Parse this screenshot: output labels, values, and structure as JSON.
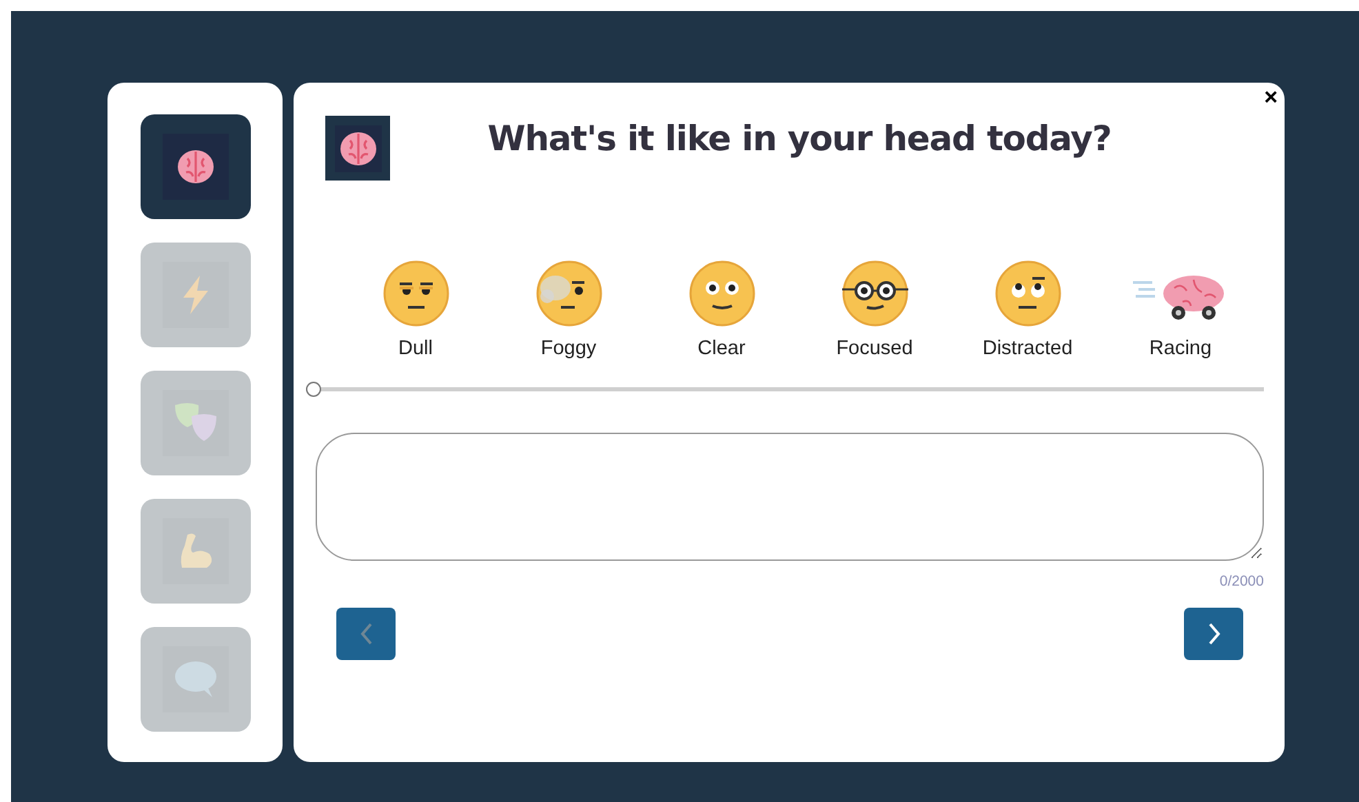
{
  "sidebar": {
    "items": [
      {
        "kind": "brain",
        "selected": true
      },
      {
        "kind": "bolt",
        "selected": false
      },
      {
        "kind": "masks",
        "selected": false
      },
      {
        "kind": "muscle",
        "selected": false
      },
      {
        "kind": "speech",
        "selected": false
      }
    ]
  },
  "question": {
    "title": "What's it like in your head today?",
    "close": "×"
  },
  "moods": [
    {
      "kind": "dull",
      "label": "Dull"
    },
    {
      "kind": "foggy",
      "label": "Foggy"
    },
    {
      "kind": "clear",
      "label": "Clear"
    },
    {
      "kind": "focused",
      "label": "Focused"
    },
    {
      "kind": "distracted",
      "label": "Distracted"
    },
    {
      "kind": "racing",
      "label": "Racing"
    }
  ],
  "slider": {
    "level": 0
  },
  "notes": {
    "counter": "0/2000"
  },
  "nav": {
    "back": {
      "disabled": true
    },
    "next": {
      "disabled": false
    }
  }
}
